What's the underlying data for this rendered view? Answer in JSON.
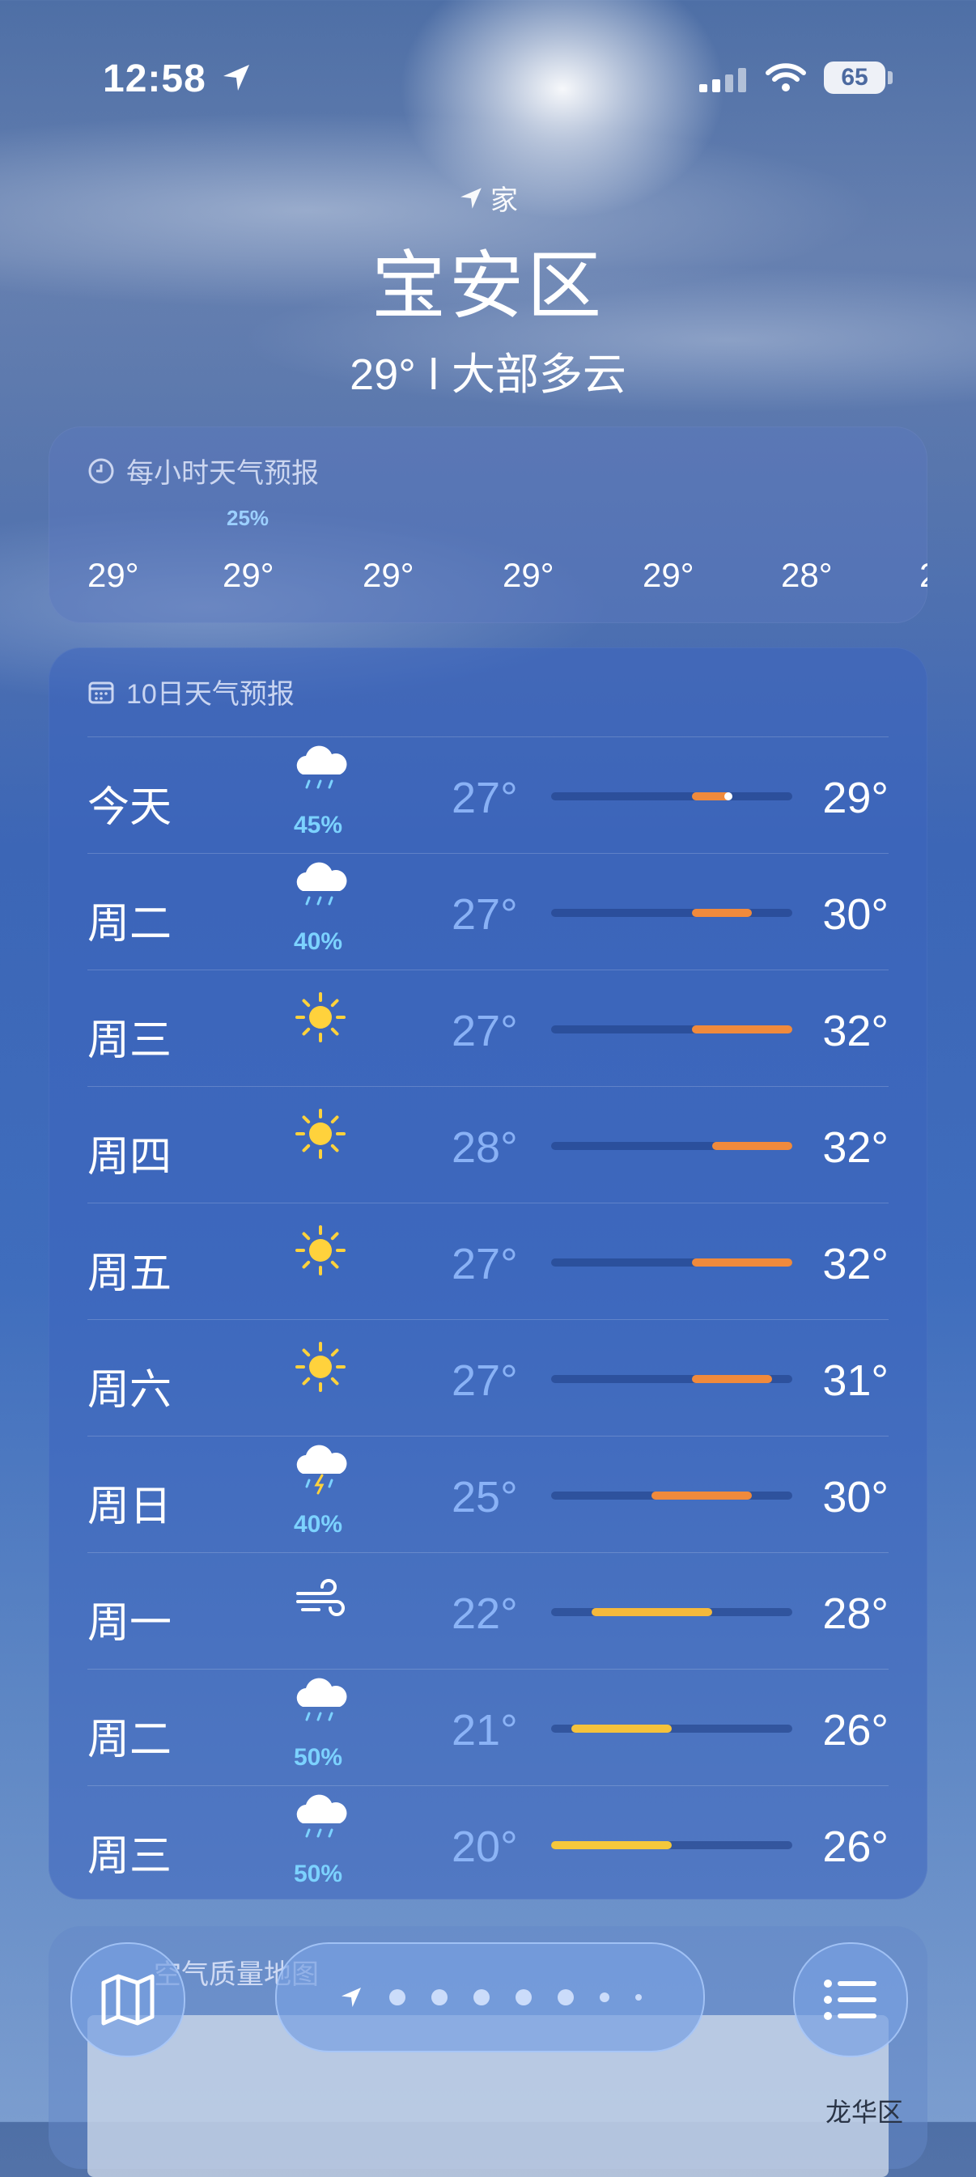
{
  "status": {
    "time": "12:58",
    "battery": "65"
  },
  "header": {
    "home_label": "家",
    "city": "宝安区",
    "summary": "29° ǀ 大部多云"
  },
  "hourly": {
    "title": "每小时天气预报",
    "precip": "25%",
    "temps": [
      "29°",
      "29°",
      "29°",
      "29°",
      "29°",
      "28°",
      "2"
    ]
  },
  "daily": {
    "title": "10日天气预报",
    "rows": [
      {
        "day": "今天",
        "icon": "rain-cloud-icon",
        "rain": "45%",
        "lo": "27°",
        "hi": "29°",
        "lo_val": 27,
        "hi_val": 29,
        "current": 29,
        "color": "#f08a3c"
      },
      {
        "day": "周二",
        "icon": "rain-cloud-icon",
        "rain": "40%",
        "lo": "27°",
        "hi": "30°",
        "lo_val": 27,
        "hi_val": 30,
        "color": "#f08a3c"
      },
      {
        "day": "周三",
        "icon": "sun-icon",
        "rain": "",
        "lo": "27°",
        "hi": "32°",
        "lo_val": 27,
        "hi_val": 32,
        "color": "#f08a3c"
      },
      {
        "day": "周四",
        "icon": "sun-icon",
        "rain": "",
        "lo": "28°",
        "hi": "32°",
        "lo_val": 28,
        "hi_val": 32,
        "color": "#f08a3c"
      },
      {
        "day": "周五",
        "icon": "sun-icon",
        "rain": "",
        "lo": "27°",
        "hi": "32°",
        "lo_val": 27,
        "hi_val": 32,
        "color": "#f08a3c"
      },
      {
        "day": "周六",
        "icon": "sun-icon",
        "rain": "",
        "lo": "27°",
        "hi": "31°",
        "lo_val": 27,
        "hi_val": 31,
        "color": "#f08a3c"
      },
      {
        "day": "周日",
        "icon": "thunderstorm-icon",
        "rain": "40%",
        "lo": "25°",
        "hi": "30°",
        "lo_val": 25,
        "hi_val": 30,
        "color": "#f08a3c"
      },
      {
        "day": "周一",
        "icon": "wind-icon",
        "rain": "",
        "lo": "22°",
        "hi": "28°",
        "lo_val": 22,
        "hi_val": 28,
        "color": "#f5b93b"
      },
      {
        "day": "周二",
        "icon": "rain-cloud-icon",
        "rain": "50%",
        "lo": "21°",
        "hi": "26°",
        "lo_val": 21,
        "hi_val": 26,
        "color": "#f5c23b"
      },
      {
        "day": "周三",
        "icon": "rain-cloud-icon",
        "rain": "50%",
        "lo": "20°",
        "hi": "26°",
        "lo_val": 20,
        "hi_val": 26,
        "color": "#f5c83b"
      }
    ],
    "range_min": 20,
    "range_max": 32
  },
  "air_quality": {
    "title": "空气质量地图",
    "district": "龙华区"
  },
  "pager": {
    "pages": 7,
    "active": 0
  }
}
